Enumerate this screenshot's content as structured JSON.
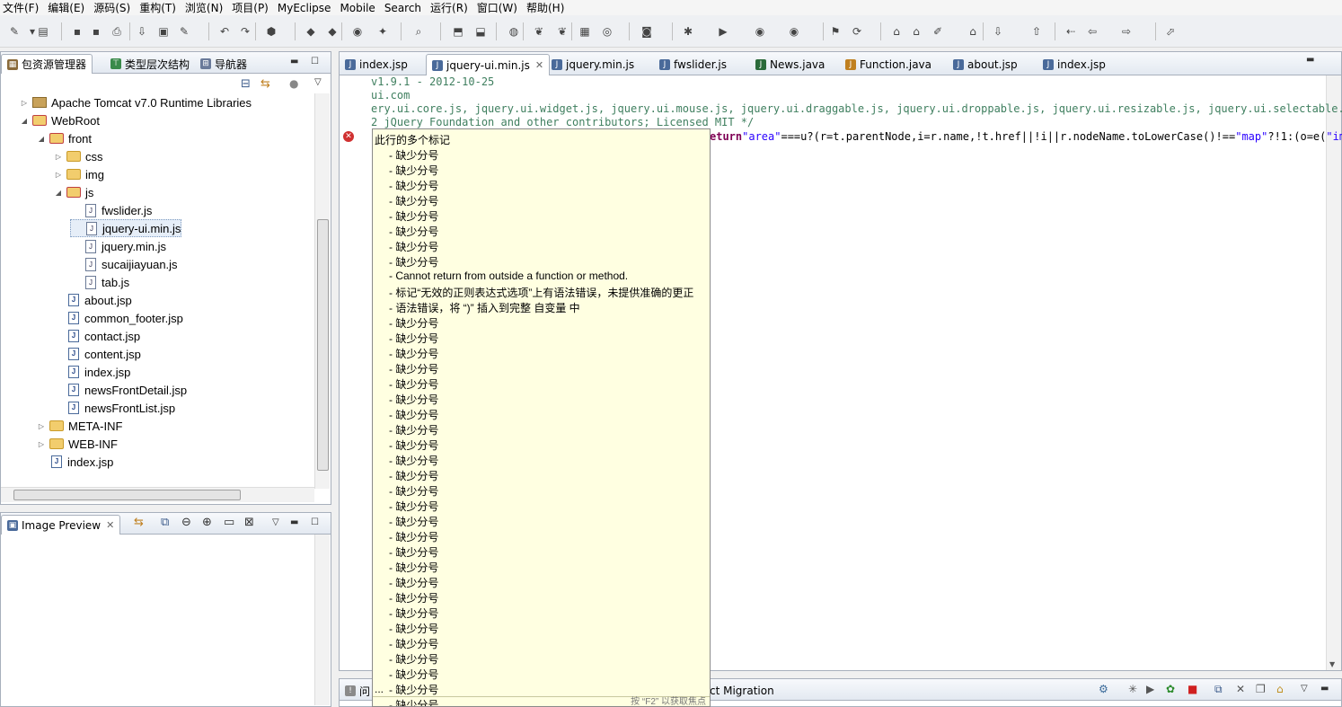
{
  "menu": [
    "文件(F)",
    "编辑(E)",
    "源码(S)",
    "重构(T)",
    "浏览(N)",
    "项目(P)",
    "MyEclipse",
    "Mobile",
    "Search",
    "运行(R)",
    "窗口(W)",
    "帮助(H)"
  ],
  "explorer": {
    "tabs": [
      {
        "label": "包资源管理器",
        "active": true
      },
      {
        "label": "类型层次结构",
        "active": false
      },
      {
        "label": "导航器",
        "active": false
      }
    ],
    "tree": [
      {
        "label": "Apache Tomcat v7.0 Runtime Libraries",
        "kind": "lib",
        "depth": 0,
        "twisty": "▷"
      },
      {
        "label": "WebRoot",
        "kind": "webroot",
        "depth": 0,
        "twisty": "◢"
      },
      {
        "label": "front",
        "kind": "webroot",
        "depth": 1,
        "twisty": "◢"
      },
      {
        "label": "css",
        "kind": "folder",
        "depth": 2,
        "twisty": "▷"
      },
      {
        "label": "img",
        "kind": "folder",
        "depth": 2,
        "twisty": "▷"
      },
      {
        "label": "js",
        "kind": "webroot",
        "depth": 2,
        "twisty": "◢"
      },
      {
        "label": "fwslider.js",
        "kind": "js",
        "depth": 3,
        "twisty": ""
      },
      {
        "label": "jquery-ui.min.js",
        "kind": "js",
        "depth": 3,
        "twisty": "",
        "selected": true
      },
      {
        "label": "jquery.min.js",
        "kind": "js",
        "depth": 3,
        "twisty": ""
      },
      {
        "label": "sucaijiayuan.js",
        "kind": "js",
        "depth": 3,
        "twisty": ""
      },
      {
        "label": "tab.js",
        "kind": "js",
        "depth": 3,
        "twisty": ""
      },
      {
        "label": "about.jsp",
        "kind": "jsp",
        "depth": 2,
        "twisty": ""
      },
      {
        "label": "common_footer.jsp",
        "kind": "jsp",
        "depth": 2,
        "twisty": ""
      },
      {
        "label": "contact.jsp",
        "kind": "jsp",
        "depth": 2,
        "twisty": ""
      },
      {
        "label": "content.jsp",
        "kind": "jsp",
        "depth": 2,
        "twisty": ""
      },
      {
        "label": "index.jsp",
        "kind": "jsp",
        "depth": 2,
        "twisty": ""
      },
      {
        "label": "newsFrontDetail.jsp",
        "kind": "jsp",
        "depth": 2,
        "twisty": ""
      },
      {
        "label": "newsFrontList.jsp",
        "kind": "jsp",
        "depth": 2,
        "twisty": ""
      },
      {
        "label": "META-INF",
        "kind": "folder",
        "depth": 1,
        "twisty": "▷"
      },
      {
        "label": "WEB-INF",
        "kind": "folder",
        "depth": 1,
        "twisty": "▷"
      },
      {
        "label": "index.jsp",
        "kind": "jsp",
        "depth": 1,
        "twisty": ""
      }
    ]
  },
  "image_preview": {
    "tab_label": "Image Preview"
  },
  "editor": {
    "tabs": [
      "index.jsp",
      "jquery-ui.min.js",
      "jquery.min.js",
      "fwslider.js",
      "News.java",
      "Function.java",
      "about.jsp",
      "index.jsp"
    ],
    "active_tab": 1,
    "lines": {
      "l1": " v1.9.1 - 2012-10-25",
      "l2": "ui.com",
      "l3": "ery.ui.core.js, jquery.ui.widget.js, jquery.ui.mouse.js, jquery.ui.draggable.js, jquery.ui.droppable.js, jquery.ui.resizable.js, jquery.ui.selectable.js,",
      "l4": "2 jQuery Foundation and other contributors; Licensed MIT */",
      "l5_kw": "eturn",
      "l5_str1": "\"area\"",
      "l5_mid": "===u?(r=t.parentNode,i=r.name,!t.href||!i||r.nodeName.toLowerCase()!==",
      "l5_str2": "\"map\"",
      "l5_tail": "?!1:(o=e(",
      "l5_str3": "\"img"
    }
  },
  "popup": {
    "title": "此行的多个标记",
    "items": [
      "- 缺少分号",
      "- 缺少分号",
      "- 缺少分号",
      "- 缺少分号",
      "- 缺少分号",
      "- 缺少分号",
      "- 缺少分号",
      "- 缺少分号",
      "- Cannot return from outside a function or method.",
      "- 标记“无效的正则表达式选项”上有语法错误，未提供准确的更正",
      "- 语法错误，将 “)” 插入到完整 自变量 中",
      "- 缺少分号",
      "- 缺少分号",
      "- 缺少分号",
      "- 缺少分号",
      "- 缺少分号",
      "- 缺少分号",
      "- 缺少分号",
      "- 缺少分号",
      "- 缺少分号",
      "- 缺少分号",
      "- 缺少分号",
      "- 缺少分号",
      "- 缺少分号",
      "- 缺少分号",
      "- 缺少分号",
      "- 缺少分号",
      "- 缺少分号",
      "- 缺少分号",
      "- 缺少分号",
      "- 缺少分号",
      "- 缺少分号",
      "- 缺少分号",
      "- 缺少分号",
      "- 缺少分号",
      "- 缺少分号",
      "- 缺少分号"
    ],
    "ellipsis": "...",
    "footer": "按 “F2” 以获取焦点"
  },
  "bottom": {
    "tab_partial": "问",
    "migration_label": "ct Migration"
  }
}
